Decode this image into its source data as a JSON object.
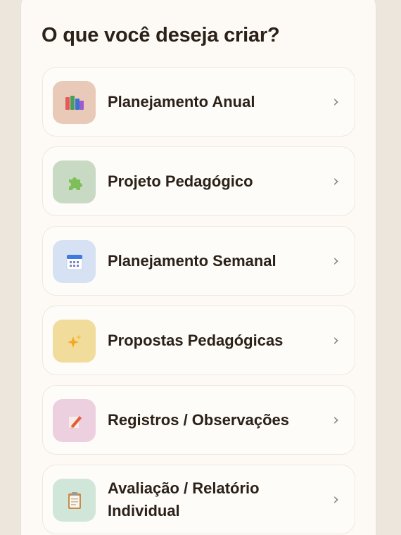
{
  "heading": "O que você deseja criar?",
  "options": [
    {
      "label": "Planejamento Anual",
      "icon": "books-icon",
      "icon_bg": "#e9c9b8"
    },
    {
      "label": "Projeto Pedagógico",
      "icon": "puzzle-icon",
      "icon_bg": "#c9dac4"
    },
    {
      "label": "Planejamento Semanal",
      "icon": "calendar-icon",
      "icon_bg": "#d6e2f3"
    },
    {
      "label": "Propostas Pedagógicas",
      "icon": "sparkles-icon",
      "icon_bg": "#f1dc9c"
    },
    {
      "label": "Registros / Observações",
      "icon": "pencil-icon",
      "icon_bg": "#ecd0e0"
    },
    {
      "label": "Avaliação / Relatório\nIndividual",
      "icon": "clipboard-icon",
      "icon_bg": "#cfe6d8"
    }
  ],
  "chevron": "›"
}
